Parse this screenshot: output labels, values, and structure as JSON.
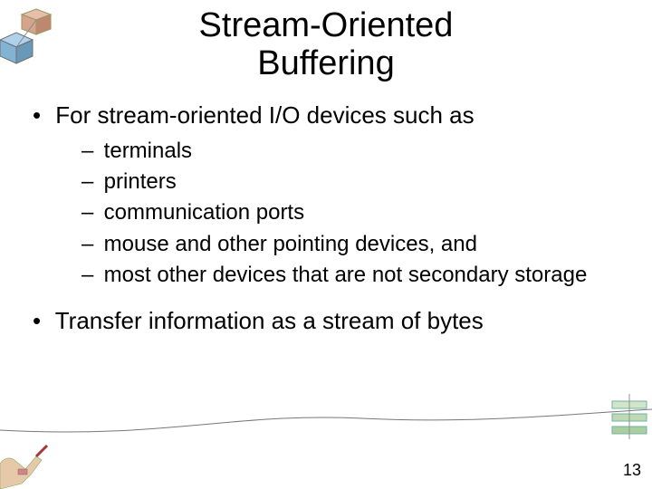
{
  "title_line1": "Stream-Oriented",
  "title_line2": "Buffering",
  "bullets": {
    "b1": "For stream-oriented I/O devices such as",
    "sub": [
      "terminals",
      "printers",
      "communication ports",
      "mouse and other pointing devices, and",
      "most other devices that are not secondary storage"
    ],
    "b2": "Transfer information as a stream of bytes"
  },
  "page_number": "13",
  "markers": {
    "level1": "•",
    "level2": "–"
  }
}
